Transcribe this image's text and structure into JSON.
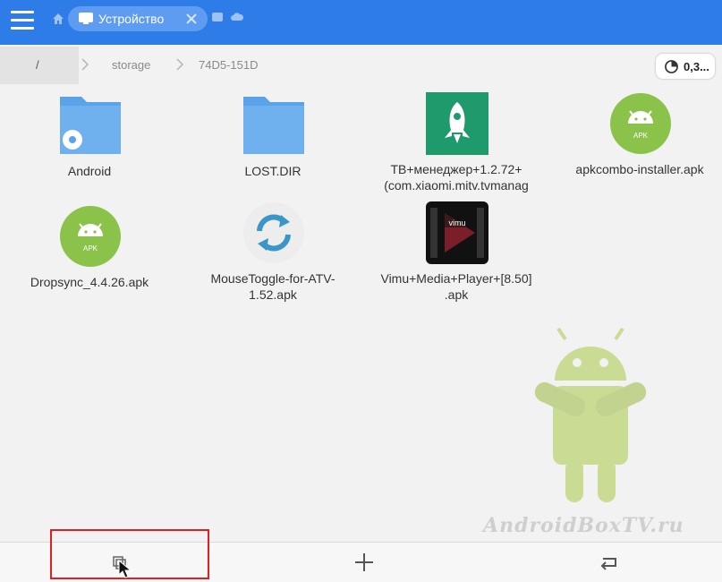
{
  "header": {
    "tab_label": "Устройство"
  },
  "path": {
    "root": "/",
    "segments": [
      "storage",
      "74D5-151D"
    ],
    "storage_usage": "0,3..."
  },
  "files": [
    {
      "name": "Android",
      "icon": "folder-settings-icon"
    },
    {
      "name": "LOST.DIR",
      "icon": "folder-icon"
    },
    {
      "name": "ТВ+менеджер+1.2.72+\n(com.xiaomi.mitv.tvmanag",
      "icon": "rocket-app-icon"
    },
    {
      "name": "apkcombo-installer.apk",
      "icon": "android-apk-icon"
    },
    {
      "name": "Dropsync_4.4.26.apk",
      "icon": "android-apk-icon"
    },
    {
      "name": "MouseToggle-for-ATV-\n1.52.apk",
      "icon": "refresh-circle-icon"
    },
    {
      "name": "Vimu+Media+Player+[8.50]\n.apk",
      "icon": "vimu-app-icon"
    }
  ],
  "watermark": "AndroidBoxTV.ru",
  "colors": {
    "header": "#2d7ce8",
    "folder": "#5aa3e8",
    "apk": "#8bc34a",
    "highlight": "#e02020"
  }
}
